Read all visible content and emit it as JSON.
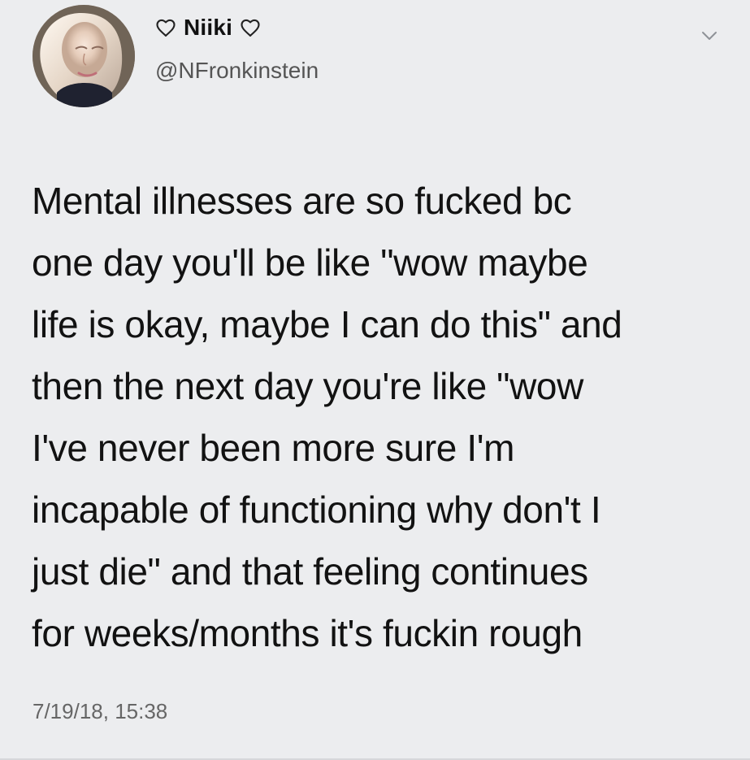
{
  "tweet": {
    "display_name": "Niiki",
    "handle": "@NFronkinstein",
    "text": "Mental illnesses are so fucked bc\none day you'll be like \"wow maybe\nlife is okay, maybe I can do this\" and\nthen the next day you're like \"wow\nI've never been more sure I'm\nincapable of functioning why don't I\njust die\" and that feeling continues\nfor weeks/months it's fuckin rough",
    "timestamp": "7/19/18, 15:38"
  },
  "icons": {
    "left_heart": "heart-outline-icon",
    "right_heart": "heart-outline-icon",
    "menu": "chevron-down-icon"
  },
  "colors": {
    "background": "#ecedef",
    "text": "#111111",
    "muted": "#666666"
  }
}
